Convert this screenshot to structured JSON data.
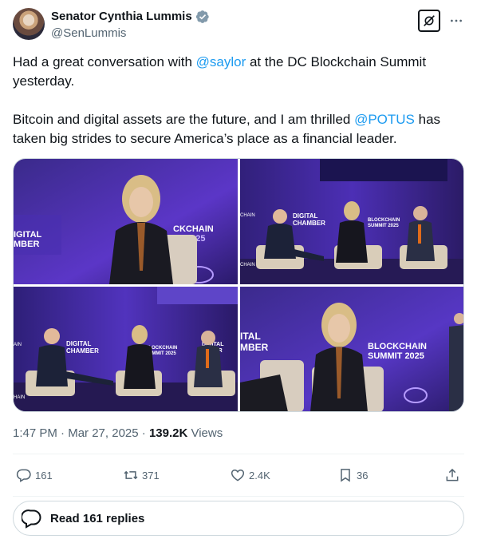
{
  "author": {
    "display_name": "Senator Cynthia Lummis",
    "handle": "@SenLummis",
    "verified": true,
    "verified_badge_color": "#829aab"
  },
  "tweet": {
    "para1_before": "Had a great conversation with ",
    "para1_mention": "@saylor",
    "para1_after": " at the DC Blockchain Summit yesterday.",
    "para2_before": "Bitcoin and digital assets are the future, and I am thrilled ",
    "para2_mention": "@POTUS",
    "para2_after": " has taken big strides to secure America’s place as a financial leader.",
    "mention_color": "#1d9bf0"
  },
  "media": {
    "photos": [
      {
        "id": "photo-1",
        "backdrop_left": "IGITAL\nMBER",
        "backdrop_right": "CKCHAIN\n2025"
      },
      {
        "id": "photo-2",
        "stage_text": "DIGITAL\nCHAMBER",
        "stage_text_2": "BLOCKCHAIN\nSUMMIT 2025"
      },
      {
        "id": "photo-3",
        "stage_text": "DIGITAL\nCHAMBER",
        "stage_text_2": "BLOCKCHAIN\nSUMMIT 2025"
      },
      {
        "id": "photo-4",
        "backdrop_left": "ITAL\nMBER",
        "backdrop_right": "BLOCKCHAIN\nSUMMIT 2025"
      }
    ]
  },
  "meta": {
    "time": "1:47 PM",
    "separator": " · ",
    "date": "Mar 27, 2025",
    "views_count": "139.2K",
    "views_label": " Views"
  },
  "actions": {
    "replies": "161",
    "reposts": "371",
    "likes": "2.4K",
    "bookmarks": "36"
  },
  "read_replies_label": "Read 161 replies"
}
